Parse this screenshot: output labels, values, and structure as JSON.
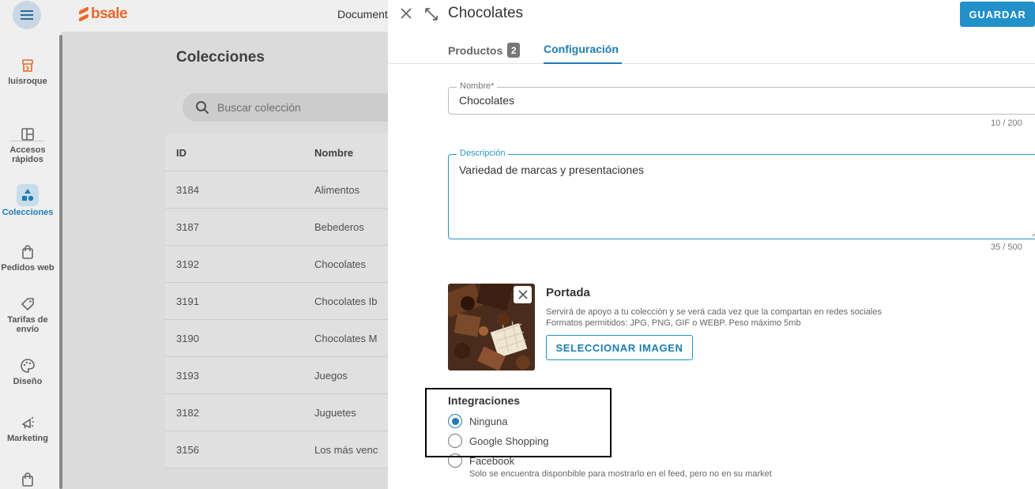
{
  "app": {
    "logo_text": "bsale",
    "top_link": "Documento",
    "brand_color": "#e86a2a",
    "accent_color": "#1e7cb2"
  },
  "sidebar": {
    "items": [
      {
        "label": "luisroque",
        "icon": "store-icon"
      },
      {
        "label": "Accesos rápidos",
        "icon": "layout-icon"
      },
      {
        "label": "Colecciones",
        "icon": "shapes-icon",
        "active": true
      },
      {
        "label": "Pedidos web",
        "icon": "shopping-bag-icon"
      },
      {
        "label": "Tarifas de envío",
        "icon": "tag-icon"
      },
      {
        "label": "Diseño",
        "icon": "palette-icon"
      },
      {
        "label": "Marketing",
        "icon": "megaphone-icon"
      }
    ]
  },
  "main": {
    "title": "Colecciones",
    "search_placeholder": "Buscar colección",
    "columns": [
      "ID",
      "Nombre"
    ],
    "rows": [
      {
        "id": "3184",
        "name": "Alimentos"
      },
      {
        "id": "3187",
        "name": "Bebederos"
      },
      {
        "id": "3192",
        "name": "Chocolates"
      },
      {
        "id": "3191",
        "name": "Chocolates Ib"
      },
      {
        "id": "3190",
        "name": "Chocolates M"
      },
      {
        "id": "3193",
        "name": "Juegos"
      },
      {
        "id": "3182",
        "name": "Juguetes"
      },
      {
        "id": "3156",
        "name": "Los más venc"
      }
    ]
  },
  "drawer": {
    "title": "Chocolates",
    "save_label": "GUARDAR",
    "tabs": {
      "products_label": "Productos",
      "products_count": "2",
      "config_label": "Configuración"
    },
    "name_field": {
      "label": "Nombre*",
      "value": "Chocolates",
      "counter": "10 / 200"
    },
    "desc_field": {
      "label": "Descripción",
      "value": "Variedad de marcas y presentaciones",
      "counter": "35 / 500"
    },
    "cover": {
      "title": "Portada",
      "desc_line1": "Servirá de apoyo a tu colección y se verá cada vez que la compartan en redes sociales",
      "desc_line2": "Formatos permitidos: JPG, PNG, GIF o WEBP. Peso máximo 5mb",
      "button_label": "SELECCIONAR IMAGEN"
    },
    "integrations": {
      "title": "Integraciones",
      "options": [
        {
          "label": "Ninguna",
          "selected": true
        },
        {
          "label": "Google Shopping",
          "selected": false
        },
        {
          "label": "Facebook",
          "selected": false
        }
      ],
      "facebook_note": "Solo se encuentra disponbible para mostrarlo en el feed, pero no en su market"
    }
  }
}
